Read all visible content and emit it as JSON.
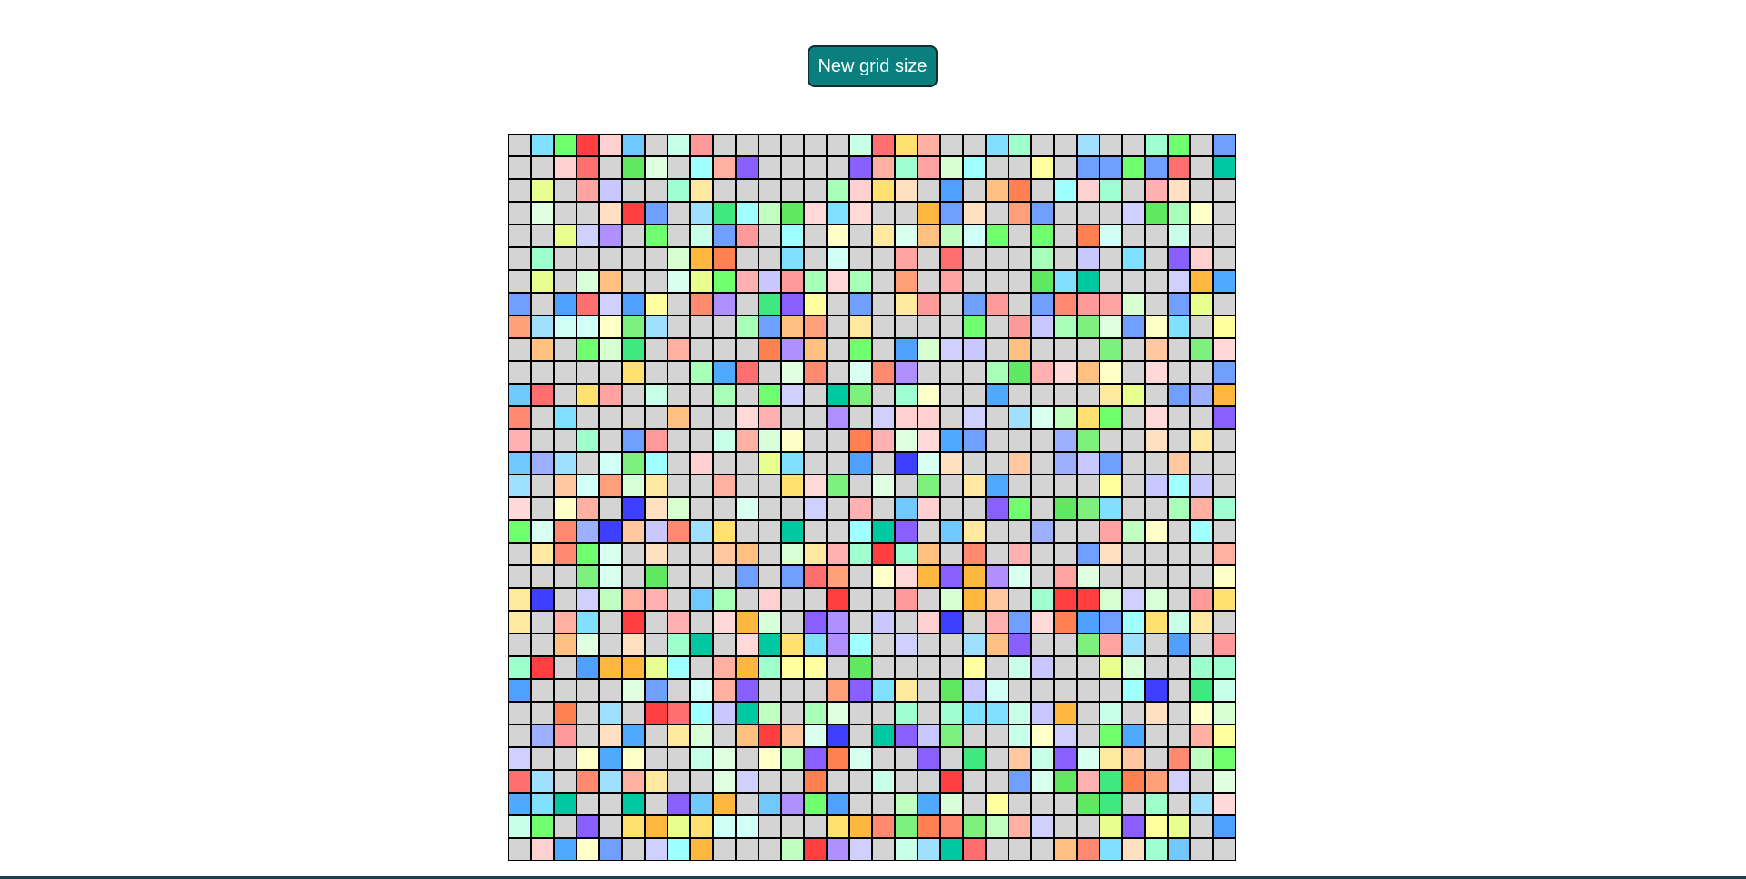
{
  "button": {
    "label": "New grid size"
  },
  "grid": {
    "size": 32,
    "colors": {
      "default": "#d4d4d4",
      "border": "#000000",
      "palette": [
        "#ffa3a3",
        "#7df07d",
        "#ffa07a",
        "#d4d4d4",
        "#d0d0ff",
        "#ffd0d0",
        "#c8ffe8",
        "#d8ffd8",
        "#a0ffff",
        "#9cb0ff",
        "#a8ffb8",
        "#9cffcc",
        "#70c8ff",
        "#ffffa0",
        "#d8ffd0",
        "#ffd8d8",
        "#d0fff8",
        "#e0ffe0",
        "#d8fff0",
        "#6fff6f",
        "#6f9fff",
        "#ffc8a0",
        "#ffe070",
        "#c8c8ff",
        "#c0ffc0",
        "#ffffc8",
        "#ff9a9a",
        "#a0ffd0",
        "#ffe0c0",
        "#a0e0ff",
        "#b090ff",
        "#ffb0b0",
        "#ffe8a0",
        "#ff8a70",
        "#ffc080",
        "#6fa0ff",
        "#3f3fff",
        "#ff6f6f",
        "#8a5fff",
        "#00c8a0",
        "#4faaff",
        "#ff3f3f",
        "#ffb83f",
        "#ff8050",
        "#50a0ff",
        "#40e880",
        "#60e860",
        "#7fe0ff",
        "#ffb0a0",
        "#e8ff8f"
      ]
    }
  }
}
